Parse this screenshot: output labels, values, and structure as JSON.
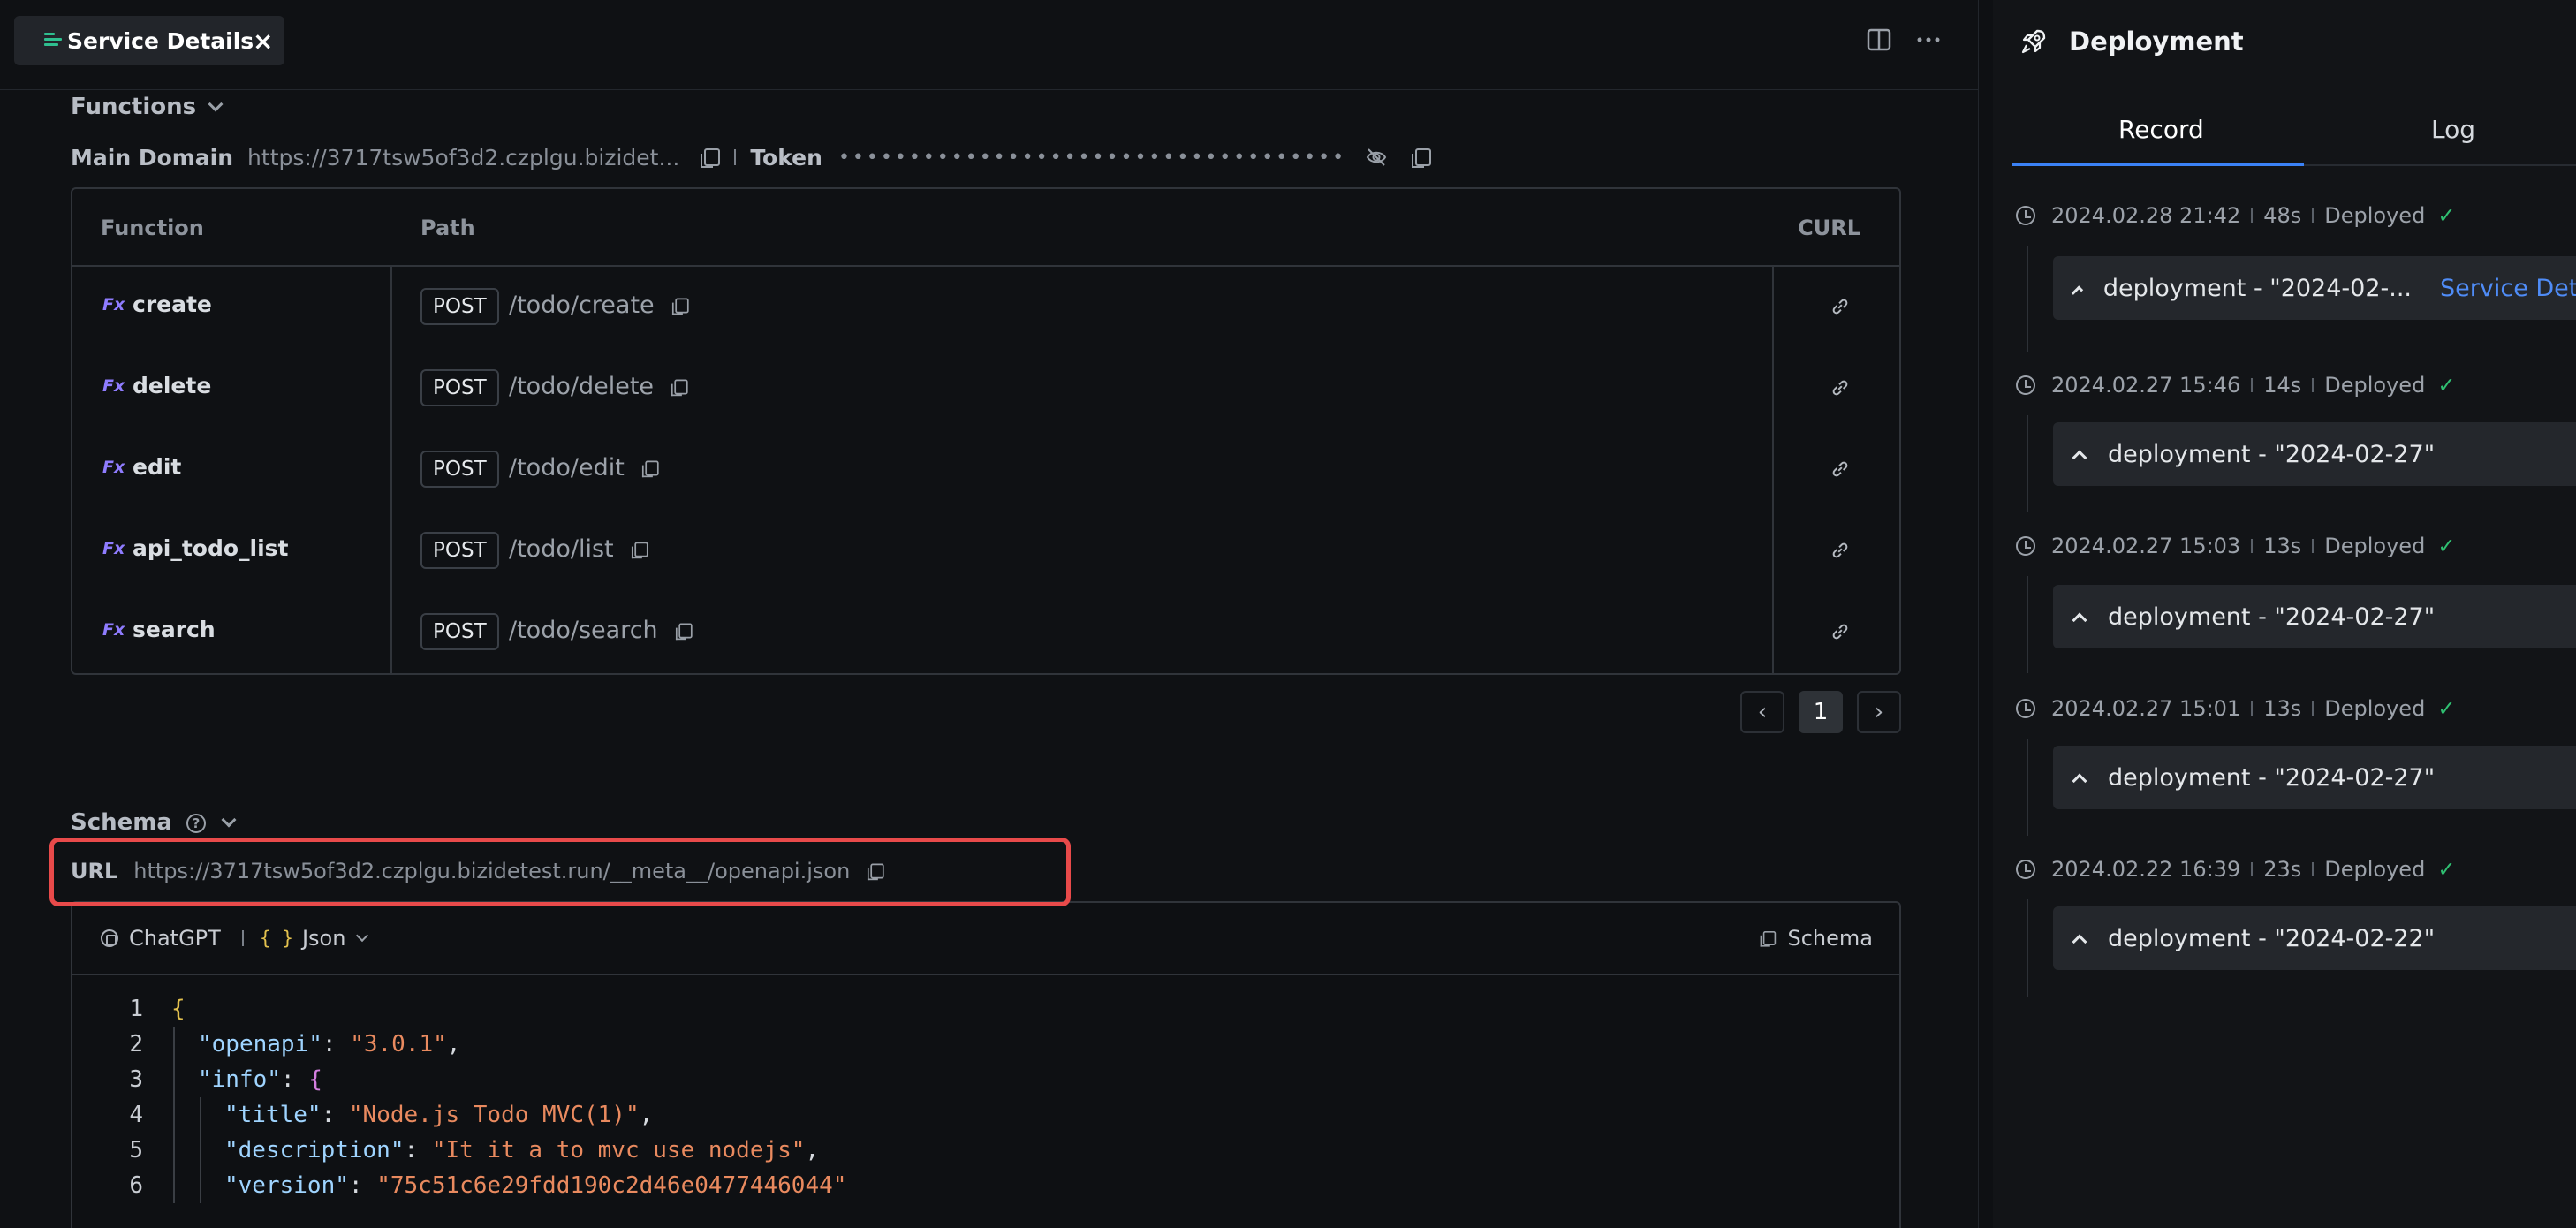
{
  "tab": {
    "title": "Service Details",
    "close": "×"
  },
  "functions": {
    "title": "Functions",
    "main_domain_label": "Main Domain",
    "main_domain_value": "https://3717tsw5of3d2.czplgu.bizidet...",
    "token_label": "Token",
    "token_value": "••••••••••••••••••••••••••••••••••••",
    "columns": {
      "function": "Function",
      "path": "Path",
      "curl": "CURL"
    },
    "fx_badge": "Fx",
    "rows": [
      {
        "name": "create",
        "method": "POST",
        "path": "/todo/create"
      },
      {
        "name": "delete",
        "method": "POST",
        "path": "/todo/delete"
      },
      {
        "name": "edit",
        "method": "POST",
        "path": "/todo/edit"
      },
      {
        "name": "api_todo_list",
        "method": "POST",
        "path": "/todo/list"
      },
      {
        "name": "search",
        "method": "POST",
        "path": "/todo/search"
      }
    ],
    "pagination": {
      "prev": "‹",
      "page": "1",
      "next": "›"
    }
  },
  "schema": {
    "title": "Schema",
    "help": "?",
    "url_label": "URL",
    "url_value": "https://3717tsw5of3d2.czplgu.bizidetest.run/__meta__/openapi.json",
    "toolbar": {
      "chatgpt": "ChatGPT",
      "braces": "{ }",
      "format": "Json",
      "schema_button": "Schema"
    },
    "code": {
      "line_numbers": [
        "1",
        "2",
        "3",
        "4",
        "5",
        "6"
      ],
      "open_brace": "{",
      "k_openapi": "\"openapi\"",
      "v_openapi": "\"3.0.1\"",
      "k_info": "\"info\"",
      "k_title": "\"title\"",
      "v_title": "\"Node.js Todo MVC(1)\"",
      "k_description": "\"description\"",
      "v_description": "\"It it a to mvc use nodejs\"",
      "k_version": "\"version\"",
      "v_version": "\"75c51c6e29fdd190c2d46e0477446044\""
    }
  },
  "deployment": {
    "title": "Deployment",
    "tabs": [
      "Record",
      "Log"
    ],
    "records": [
      {
        "time": "2024.02.28 21:42",
        "duration": "48s",
        "status": "Deployed",
        "card": "deployment - \"2024-02-...",
        "link": "Service Details"
      },
      {
        "time": "2024.02.27 15:46",
        "duration": "14s",
        "status": "Deployed",
        "card": "deployment - \"2024-02-27\""
      },
      {
        "time": "2024.02.27 15:03",
        "duration": "13s",
        "status": "Deployed",
        "card": "deployment - \"2024-02-27\""
      },
      {
        "time": "2024.02.27 15:01",
        "duration": "13s",
        "status": "Deployed",
        "card": "deployment - \"2024-02-27\""
      },
      {
        "time": "2024.02.22 16:39",
        "duration": "23s",
        "status": "Deployed",
        "card": "deployment - \"2024-02-22\""
      }
    ],
    "check": "✓"
  },
  "colors": {
    "accent": "#3b82f6",
    "success": "#2fbf71",
    "highlight": "#e84a4a",
    "fx": "#8f7cff"
  }
}
